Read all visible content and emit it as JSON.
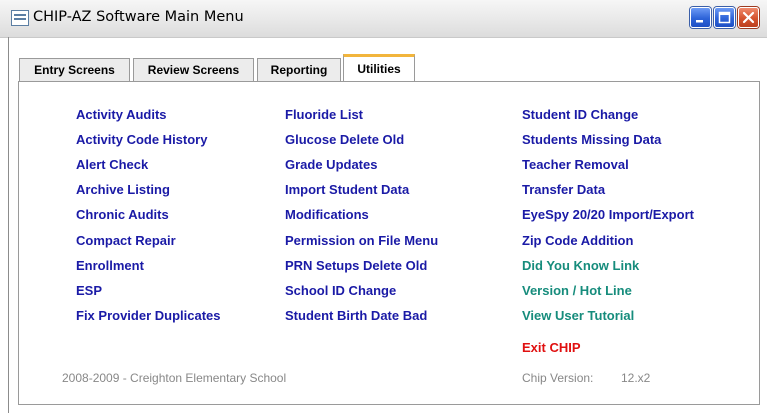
{
  "window": {
    "title": "CHIP-AZ Software Main Menu"
  },
  "tabs": [
    {
      "label": "Entry Screens"
    },
    {
      "label": "Review Screens"
    },
    {
      "label": "Reporting"
    },
    {
      "label": "Utilities"
    }
  ],
  "active_tab": "Utilities",
  "utilities": {
    "col1": [
      "Activity Audits",
      "Activity Code History",
      "Alert Check",
      "Archive Listing",
      "Chronic Audits",
      "Compact Repair",
      "Enrollment",
      "ESP",
      "Fix Provider Duplicates"
    ],
    "col2": [
      "Fluoride List",
      "Glucose Delete Old",
      "Grade Updates",
      "Import Student Data",
      "Modifications",
      "Permission on File Menu",
      "PRN Setups Delete Old",
      "School ID Change",
      "Student Birth Date Bad"
    ],
    "col3": [
      "Student ID Change",
      "Students Missing Data",
      "Teacher Removal",
      "Transfer Data",
      "EyeSpy 20/20 Import/Export",
      "Zip Code Addition"
    ],
    "help_links": [
      "Did You Know Link",
      "Version / Hot Line",
      "View User Tutorial"
    ],
    "exit_label": "Exit CHIP"
  },
  "footer": {
    "school": "2008-2009 - Creighton Elementary School",
    "version_label": "Chip Version:",
    "version_value": "12.x2"
  },
  "colors": {
    "link": "#1a1aa6",
    "help_link": "#168c7c",
    "exit": "#e01010",
    "active_tab_accent": "#f2b53c"
  }
}
